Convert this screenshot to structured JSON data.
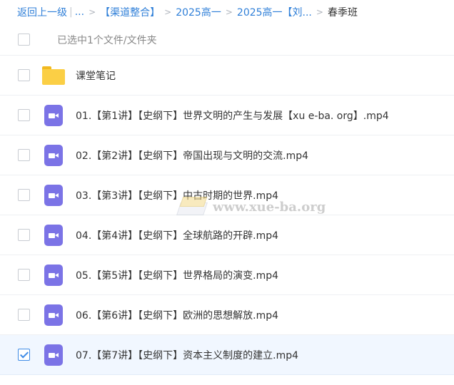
{
  "breadcrumb": {
    "back": "返回上一级",
    "pipe": "|",
    "ellipsis": "...",
    "sep": ">",
    "crumbs": [
      "【渠道整合】",
      "2025高一",
      "2025高一【刘..."
    ],
    "current": "春季班"
  },
  "header": {
    "selected_text": "已选中1个文件/文件夹"
  },
  "files": [
    {
      "name": "课堂笔记",
      "type": "folder",
      "checked": false
    },
    {
      "name": "01.【第1讲】【史纲下】世界文明的产生与发展【xu e-ba. org】.mp4",
      "type": "video",
      "checked": false
    },
    {
      "name": "02.【第2讲】【史纲下】帝国出现与文明的交流.mp4",
      "type": "video",
      "checked": false
    },
    {
      "name": "03.【第3讲】【史纲下】中古时期的世界.mp4",
      "type": "video",
      "checked": false
    },
    {
      "name": "04.【第4讲】【史纲下】全球航路的开辟.mp4",
      "type": "video",
      "checked": false
    },
    {
      "name": "05.【第5讲】【史纲下】世界格局的演变.mp4",
      "type": "video",
      "checked": false
    },
    {
      "name": "06.【第6讲】【史纲下】欧洲的思想解放.mp4",
      "type": "video",
      "checked": false
    },
    {
      "name": "07.【第7讲】【史纲下】资本主义制度的建立.mp4",
      "type": "video",
      "checked": true
    }
  ],
  "watermark": {
    "text": "www.xue-ba.org"
  },
  "colors": {
    "link": "#2f7fd8",
    "video_icon": "#7b73e6",
    "folder": "#fbcf45",
    "selected_bg": "#f1f7ff",
    "check": "#3e8be6"
  }
}
